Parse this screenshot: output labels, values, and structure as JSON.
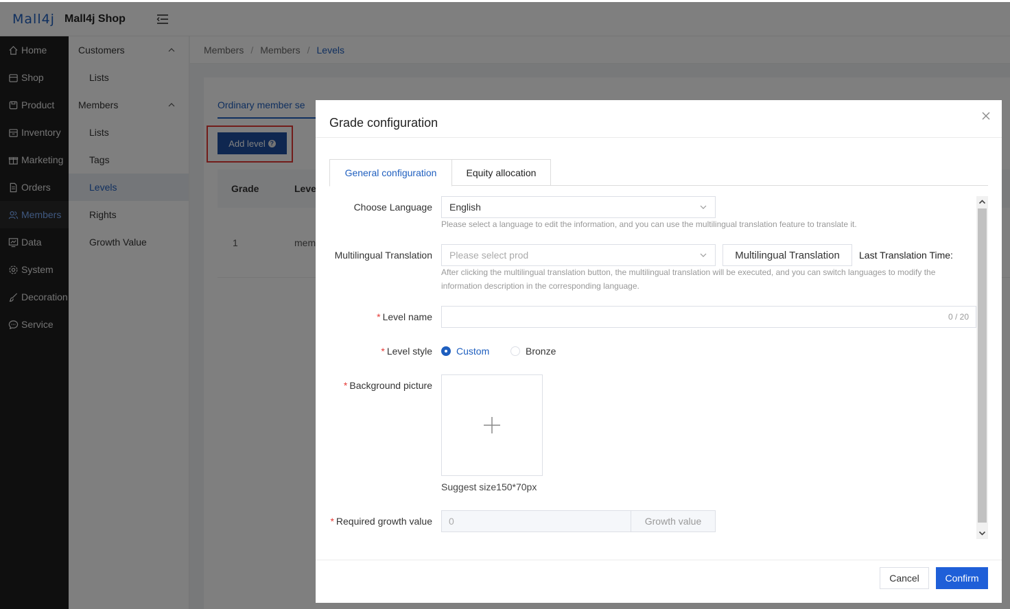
{
  "header": {
    "logo": "Mall4j",
    "shop_name": "Mall4j Shop"
  },
  "sidebar": {
    "items": [
      {
        "label": "Home",
        "icon": "home-icon"
      },
      {
        "label": "Shop",
        "icon": "shop-icon"
      },
      {
        "label": "Product",
        "icon": "product-icon"
      },
      {
        "label": "Inventory",
        "icon": "inventory-icon"
      },
      {
        "label": "Marketing",
        "icon": "gift-icon"
      },
      {
        "label": "Orders",
        "icon": "document-icon"
      },
      {
        "label": "Members",
        "icon": "members-icon",
        "active": true
      },
      {
        "label": "Data",
        "icon": "chart-icon"
      },
      {
        "label": "System",
        "icon": "gear-icon"
      },
      {
        "label": "Decoration",
        "icon": "brush-icon"
      },
      {
        "label": "Service",
        "icon": "chat-icon"
      }
    ]
  },
  "submenu": {
    "customers": "Customers",
    "customers_lists": "Lists",
    "members": "Members",
    "members_lists": "Lists",
    "tags": "Tags",
    "levels": "Levels",
    "rights": "Rights",
    "growth_value": "Growth Value"
  },
  "breadcrumb": [
    "Members",
    "Members",
    "Levels"
  ],
  "page": {
    "tab_ordinary": "Ordinary member se",
    "add_level": "Add level",
    "col_grade": "Grade",
    "col_level": "Leve",
    "row_grade": "1",
    "row_level": "mem"
  },
  "dialog": {
    "title": "Grade configuration",
    "tabs": [
      "General configuration",
      "Equity allocation"
    ],
    "choose_language_label": "Choose Language",
    "language_value": "English",
    "language_hint": "Please select a language to edit the information, and you can use the multilingual translation feature to translate it.",
    "multilingual_label": "Multilingual Translation",
    "multilingual_placeholder": "Please select prod",
    "multilingual_button": "Multilingual Translation",
    "last_translation": "Last Translation Time:",
    "multilingual_hint_1": "After clicking the multilingual translation button, the multilingual translation will be executed, and you can switch languages to modify the",
    "multilingual_hint_2": "information description in the corresponding language.",
    "level_name_label": "Level name",
    "level_name_counter": "0 / 20",
    "level_style_label": "Level style",
    "style_custom": "Custom",
    "style_bronze": "Bronze",
    "background_label": "Background picture",
    "suggest_size": "Suggest size150*70px",
    "growth_label": "Required growth value",
    "growth_value": "0",
    "growth_append": "Growth value",
    "cancel": "Cancel",
    "confirm": "Confirm"
  }
}
